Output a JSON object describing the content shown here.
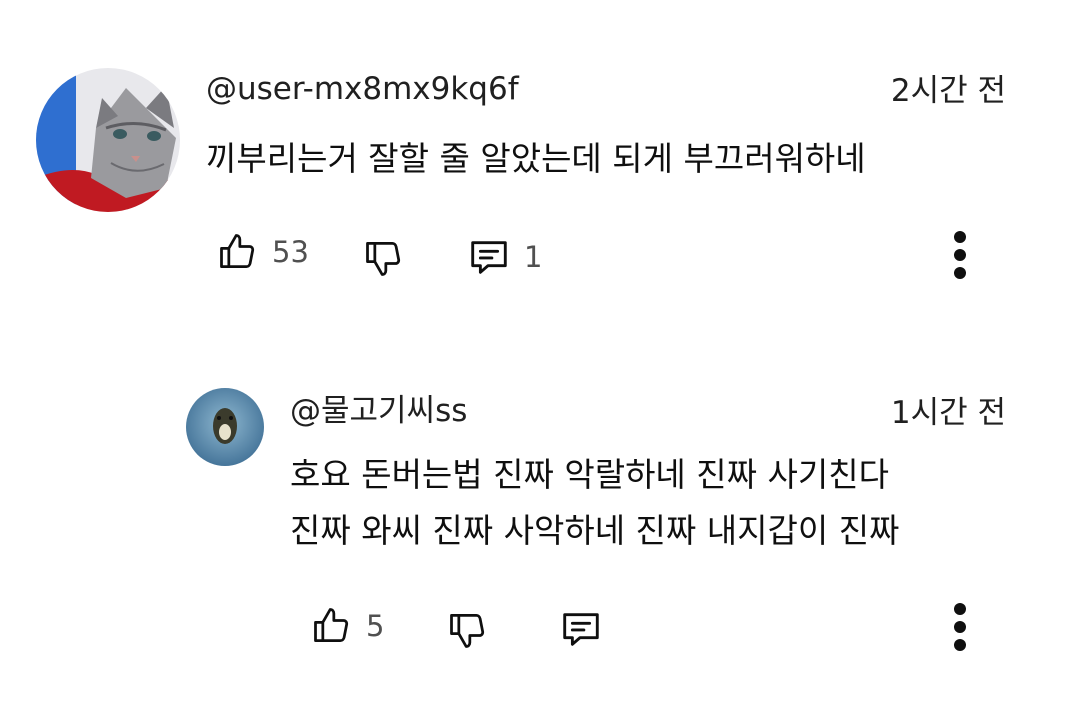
{
  "comment": {
    "author": "@user-mx8mx9kq6f",
    "time": "2시간 전",
    "text": "끼부리는거 잘할 줄 알았는데 되게 부끄러워하네",
    "likes": "53",
    "replies": "1",
    "avatar_icon": "cat-avatar"
  },
  "reply": {
    "author": "@물고기씨ss",
    "time": "1시간 전",
    "lines": [
      "호요 돈버는법 진짜 악랄하네 진짜 사기친다",
      "진짜 와씨 진짜 사악하네 진짜 내지갑이 진짜"
    ],
    "likes": "5",
    "avatar_icon": "fish-avatar"
  },
  "icons": {
    "like": "thumbs-up-icon",
    "dislike": "thumbs-down-icon",
    "reply": "comment-icon",
    "more": "more-vertical-icon"
  }
}
